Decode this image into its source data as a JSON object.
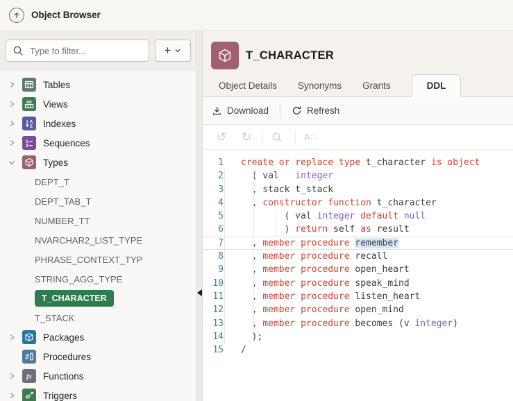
{
  "app": {
    "title": "Object Browser"
  },
  "icons": {
    "app": "up-arrow-circle",
    "filter": "magnifier",
    "add": "+",
    "add_caret": "chevron-down",
    "download": "download-tray",
    "refresh": "circular-arrow",
    "undo": "↺",
    "redo": "↻",
    "find": "magnifier",
    "text_size": "A∷",
    "collapse_panel": "left-triangle"
  },
  "palette": {
    "accent_green": "#44805a",
    "tables_icon": "#587a71",
    "views_icon": "#3f7d55",
    "indexes_icon": "#5a5b9e",
    "sequences_icon": "#7b4d99",
    "types_icon": "#9d5f6d",
    "packages_icon": "#207aa3",
    "procedures_icon": "#4c7ba0",
    "functions_icon": "#6b727b",
    "triggers_icon": "#3d7c4e",
    "object_icon": "#a06070",
    "selected_item_bg": "#2f7d4f",
    "keyword_color": "#c74634",
    "datatype_color": "#7b61c1",
    "line_number_color": "#417e95",
    "occurrence_highlight": "#d4e7f8"
  },
  "sidebar": {
    "filter_placeholder": "Type to filter...",
    "tree": [
      {
        "label": "Tables",
        "expanded": false
      },
      {
        "label": "Views",
        "expanded": false
      },
      {
        "label": "Indexes",
        "expanded": false
      },
      {
        "label": "Sequences",
        "expanded": false
      },
      {
        "label": "Types",
        "expanded": true
      },
      {
        "label": "DEPT_T"
      },
      {
        "label": "DEPT_TAB_T"
      },
      {
        "label": "NUMBER_TT"
      },
      {
        "label": "NVARCHAR2_LIST_TYPE"
      },
      {
        "label": "PHRASE_CONTEXT_TYP"
      },
      {
        "label": "STRING_AGG_TYPE"
      },
      {
        "label": "T_CHARACTER",
        "selected": true
      },
      {
        "label": "T_STACK"
      },
      {
        "label": "Packages",
        "expanded": false
      },
      {
        "label": "Procedures"
      },
      {
        "label": "Functions",
        "expanded": false
      },
      {
        "label": "Triggers",
        "expanded": false
      }
    ]
  },
  "main": {
    "object_name": "T_CHARACTER",
    "tabs": [
      {
        "label": "Object Details",
        "active": false
      },
      {
        "label": "Synonyms",
        "active": false
      },
      {
        "label": "Grants",
        "active": false
      },
      {
        "label": "DDL",
        "active": true
      }
    ],
    "toolbar": {
      "download": "Download",
      "refresh": "Refresh"
    }
  },
  "editor": {
    "current_line": 7,
    "lines": [
      {
        "num": 1,
        "tokens": [
          [
            "kw",
            "create or replace type"
          ],
          [
            "pl",
            " t_character "
          ],
          [
            "kw",
            "is object"
          ]
        ]
      },
      {
        "num": 2,
        "tokens": [
          [
            "pl",
            "  ( val   "
          ],
          [
            "ty",
            "integer"
          ]
        ]
      },
      {
        "num": 3,
        "tokens": [
          [
            "pl",
            "  , stack t_stack"
          ]
        ]
      },
      {
        "num": 4,
        "tokens": [
          [
            "pl",
            "  , "
          ],
          [
            "kw",
            "constructor function"
          ],
          [
            "pl",
            " t_character"
          ]
        ]
      },
      {
        "num": 5,
        "tokens": [
          [
            "pl",
            "        ( val "
          ],
          [
            "ty",
            "integer"
          ],
          [
            "pl",
            " "
          ],
          [
            "kw",
            "default"
          ],
          [
            "pl",
            " "
          ],
          [
            "ty",
            "null"
          ]
        ]
      },
      {
        "num": 6,
        "tokens": [
          [
            "pl",
            "        ) "
          ],
          [
            "kw",
            "return"
          ],
          [
            "pl",
            " self "
          ],
          [
            "kw",
            "as"
          ],
          [
            "pl",
            " result"
          ]
        ]
      },
      {
        "num": 7,
        "current": true,
        "tokens": [
          [
            "pl",
            "  , "
          ],
          [
            "kw",
            "member procedure"
          ],
          [
            "pl",
            " "
          ],
          [
            "hl",
            "remember"
          ]
        ]
      },
      {
        "num": 8,
        "tokens": [
          [
            "pl",
            "  , "
          ],
          [
            "kw",
            "member procedure"
          ],
          [
            "pl",
            " recall"
          ]
        ]
      },
      {
        "num": 9,
        "tokens": [
          [
            "pl",
            "  , "
          ],
          [
            "kw",
            "member procedure"
          ],
          [
            "pl",
            " open_heart"
          ]
        ]
      },
      {
        "num": 10,
        "tokens": [
          [
            "pl",
            "  , "
          ],
          [
            "kw",
            "member procedure"
          ],
          [
            "pl",
            " speak_mind"
          ]
        ]
      },
      {
        "num": 11,
        "tokens": [
          [
            "pl",
            "  , "
          ],
          [
            "kw",
            "member procedure"
          ],
          [
            "pl",
            " listen_heart"
          ]
        ]
      },
      {
        "num": 12,
        "tokens": [
          [
            "pl",
            "  , "
          ],
          [
            "kw",
            "member procedure"
          ],
          [
            "pl",
            " open_mind"
          ]
        ]
      },
      {
        "num": 13,
        "tokens": [
          [
            "pl",
            "  , "
          ],
          [
            "kw",
            "member procedure"
          ],
          [
            "pl",
            " becomes (v "
          ],
          [
            "ty",
            "integer"
          ],
          [
            "pl",
            ")"
          ]
        ]
      },
      {
        "num": 14,
        "tokens": [
          [
            "pl",
            "  );"
          ]
        ]
      },
      {
        "num": 15,
        "tokens": [
          [
            "pl",
            "/"
          ]
        ]
      }
    ]
  }
}
